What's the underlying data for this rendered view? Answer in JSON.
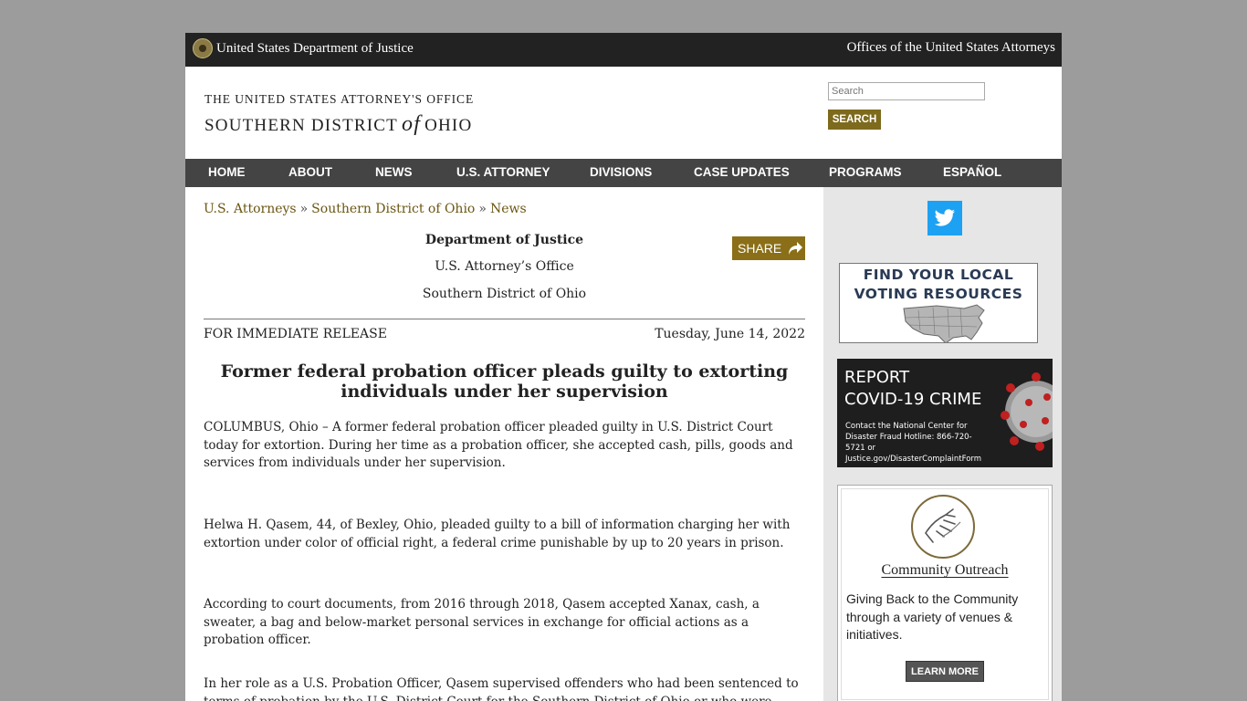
{
  "topbar": {
    "agency": "United States Department of Justice",
    "offices": "Offices of the United States Attorneys"
  },
  "header": {
    "line1": "THE UNITED STATES ATTORNEY'S OFFICE",
    "line2_a": "SOUTHERN DISTRICT",
    "line2_of": "of",
    "line2_b": "OHIO"
  },
  "search": {
    "placeholder": "Search",
    "button": "SEARCH"
  },
  "nav": [
    "HOME",
    "ABOUT",
    "NEWS",
    "U.S. ATTORNEY",
    "DIVISIONS",
    "CASE UPDATES",
    "PROGRAMS",
    "ESPAÑOL"
  ],
  "breadcrumb": {
    "item1": "U.S. Attorneys",
    "sep": "»",
    "item2": "Southern District of Ohio",
    "item3": "News"
  },
  "share_label": "SHARE",
  "press": {
    "org": "Department of Justice",
    "office": "U.S. Attorney’s Office",
    "district": "Southern District of Ohio",
    "release": "FOR IMMEDIATE RELEASE",
    "date": "Tuesday, June 14, 2022",
    "headline": "Former federal probation officer pleads guilty to extorting individuals under her supervision",
    "paragraphs": [
      "COLUMBUS, Ohio – A former federal probation officer pleaded guilty in U.S. District Court today for extortion. During her time as a probation officer, she accepted cash, pills, goods and services from individuals under her supervision.",
      "Helwa H. Qasem, 44, of Bexley, Ohio, pleaded guilty to a bill of information charging her with extortion under color of official right, a federal crime punishable by up to 20 years in prison.",
      "According to court documents, from 2016 through 2018, Qasem accepted Xanax, cash, a sweater, a bag and below-market personal services in exchange for official actions as a probation officer.",
      "In her role as a U.S. Probation Officer, Qasem supervised offenders who had been sentenced to terms of probation by the U.S. District Court for the Southern District of Ohio or who were serving terms of"
    ]
  },
  "sidebar": {
    "vote_line1": "FIND YOUR LOCAL",
    "vote_line2": "VOTING RESOURCES",
    "covid_line1": "REPORT",
    "covid_line2": "COVID-19 CRIME",
    "covid_small": "Contact the National Center for Disaster Fraud Hotline: 866-720-5721 or Justice.gov/DisasterComplaintForm",
    "outreach_title": "Community Outreach",
    "outreach_text": "Giving Back to the Community through a variety of venues & initiatives.",
    "outreach_button": "LEARN MORE"
  },
  "colors": {
    "gold": "#7d6a1c",
    "nav": "#444444",
    "topbar": "#222222",
    "twitter": "#1da1f2"
  }
}
